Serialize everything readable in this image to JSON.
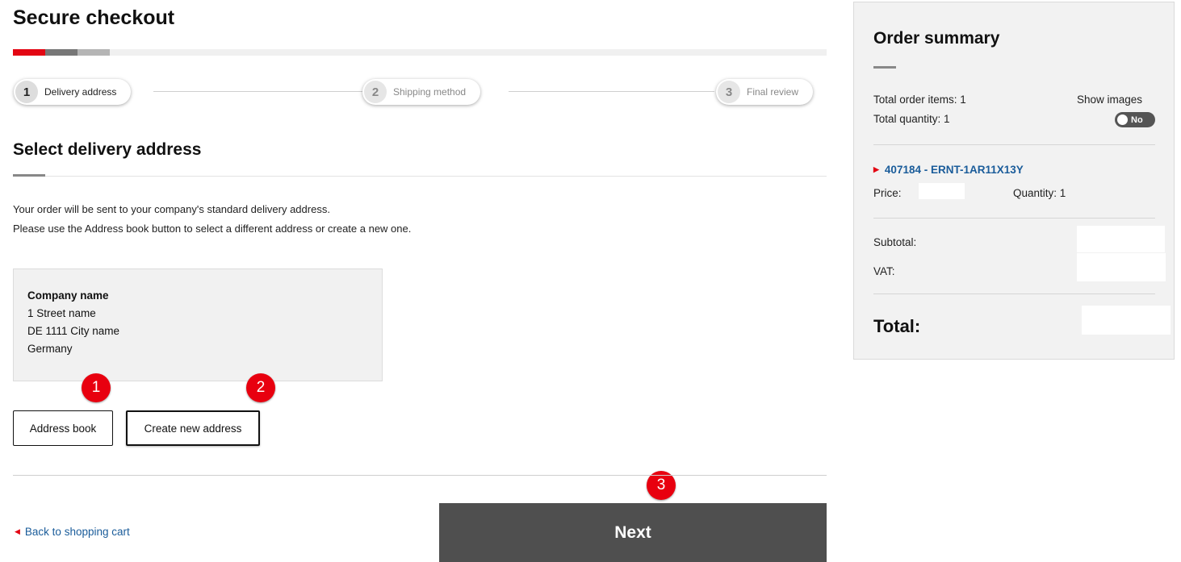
{
  "page": {
    "title": "Secure checkout"
  },
  "steps": [
    {
      "number": "1",
      "label": "Delivery address"
    },
    {
      "number": "2",
      "label": "Shipping method"
    },
    {
      "number": "3",
      "label": "Final review"
    }
  ],
  "delivery": {
    "heading": "Select delivery address",
    "info_line_1": "Your order will be sent to your company's standard delivery address.",
    "info_line_2": "Please use the Address book button to select a different address or create a new one.",
    "address": {
      "company": "Company name",
      "street": "1 Street name",
      "city": "DE 1111 City name",
      "country": "Germany"
    },
    "address_book_label": "Address book",
    "create_address_label": "Create new address"
  },
  "badges": [
    "1",
    "2",
    "3"
  ],
  "footer": {
    "back_label": "Back to shopping cart",
    "next_label": "Next"
  },
  "summary": {
    "title": "Order summary",
    "total_items": "Total order items: 1",
    "total_quantity": "Total quantity: 1",
    "show_images_label": "Show images",
    "toggle_value": "No",
    "product_link": "407184 - ERNT-1AR11X13Y",
    "price_label": "Price:",
    "quantity": "Quantity: 1",
    "subtotal_label": "Subtotal:",
    "vat_label": "VAT:",
    "total_label": "Total:"
  },
  "colors": {
    "accent_red": "#e30613",
    "link_blue": "#1a5c9a",
    "next_button": "#4f4f4f",
    "badge_red": "#e8000f"
  }
}
